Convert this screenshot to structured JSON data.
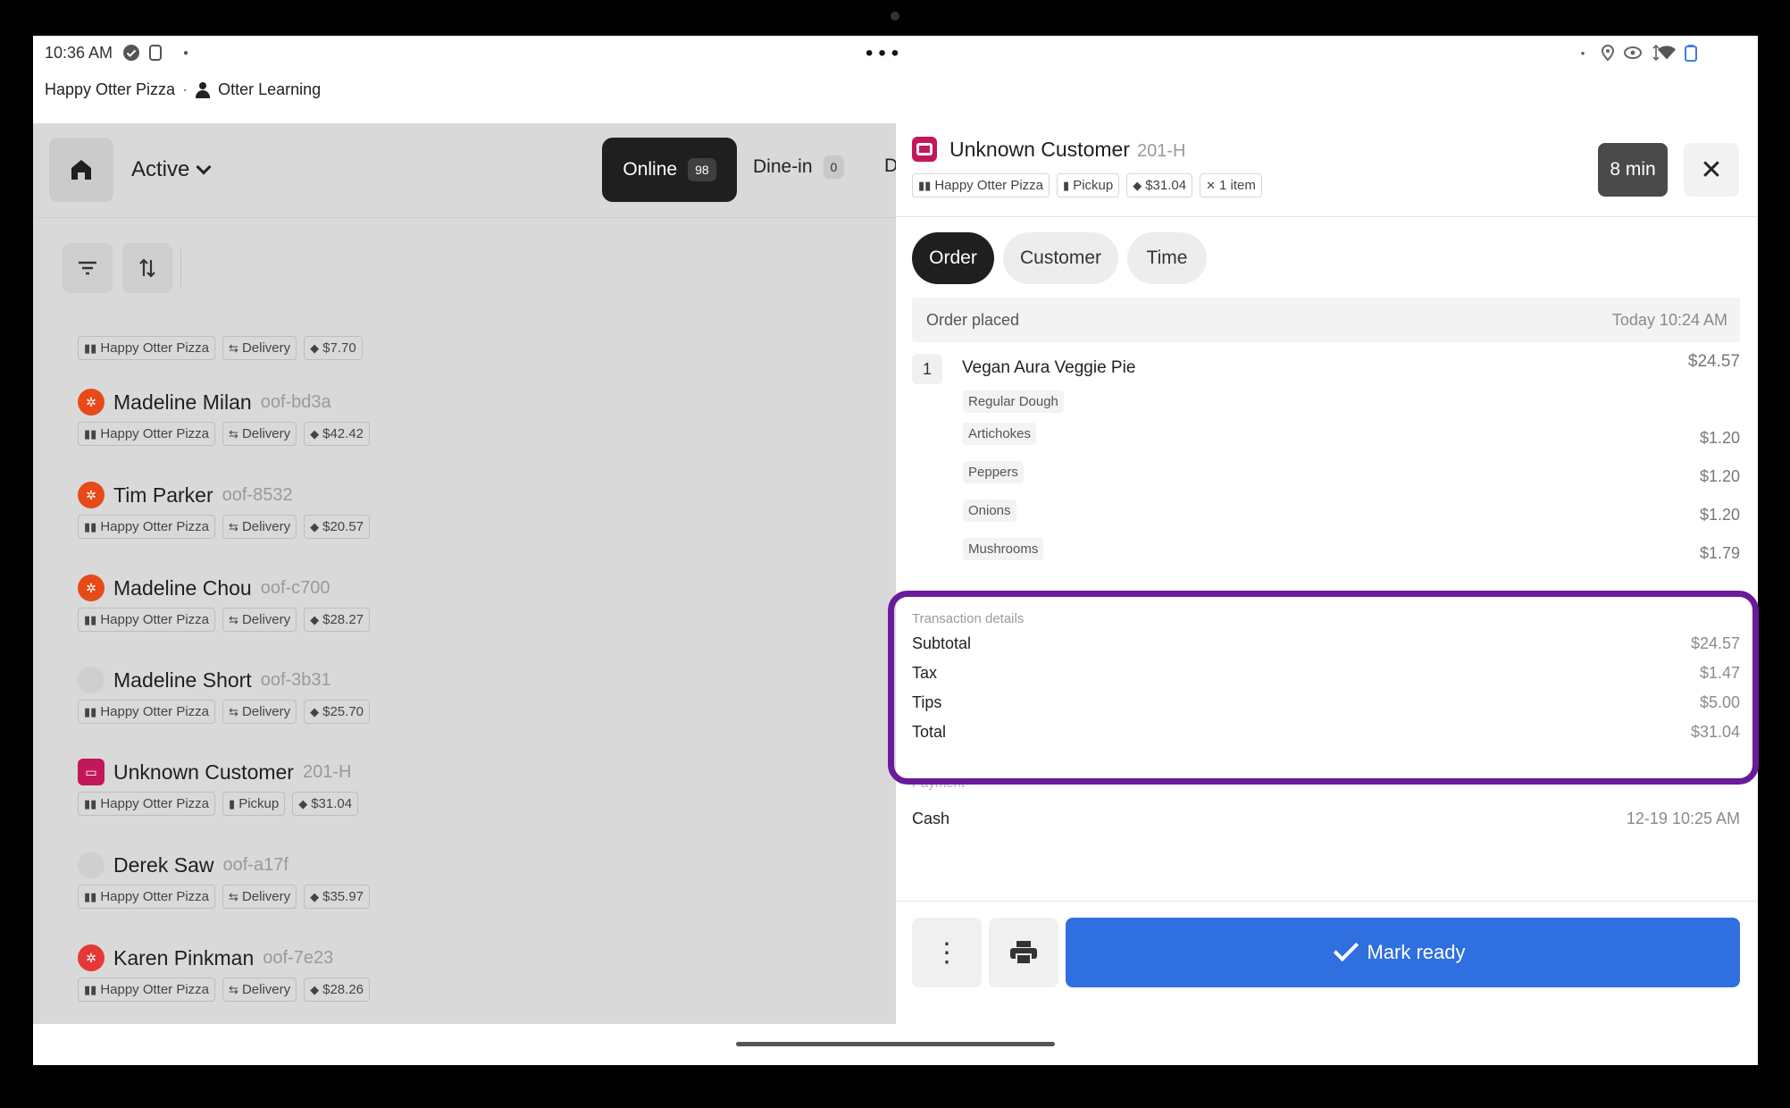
{
  "status": {
    "time": "10:36 AM",
    "store": "Happy Otter Pizza",
    "separator": "·",
    "account": "Otter Learning"
  },
  "left": {
    "filter_label": "Active",
    "tabs": [
      {
        "label": "Online",
        "count": "98"
      },
      {
        "label": "Dine-in",
        "count": "0"
      },
      {
        "label": "D"
      }
    ],
    "orders": [
      {
        "name": "",
        "id": "",
        "store": "Happy Otter Pizza",
        "type": "Delivery",
        "price": "$7.70",
        "avatar_color": "none"
      },
      {
        "name": "Madeline Milan",
        "id": "oof-bd3a",
        "store": "Happy Otter Pizza",
        "type": "Delivery",
        "price": "$42.42",
        "avatar_color": "#e64a19"
      },
      {
        "name": "Tim Parker",
        "id": "oof-8532",
        "store": "Happy Otter Pizza",
        "type": "Delivery",
        "price": "$20.57",
        "avatar_color": "#e64a19"
      },
      {
        "name": "Madeline Chou",
        "id": "oof-c700",
        "store": "Happy Otter Pizza",
        "type": "Delivery",
        "price": "$28.27",
        "avatar_color": "#e64a19"
      },
      {
        "name": "Madeline Short",
        "id": "oof-3b31",
        "store": "Happy Otter Pizza",
        "type": "Delivery",
        "price": "$25.70",
        "avatar_color": "#cfcfcf"
      },
      {
        "name": "Unknown Customer",
        "id": "201-H",
        "store": "Happy Otter Pizza",
        "type": "Pickup",
        "price": "$31.04",
        "avatar_color": "#c2185b"
      },
      {
        "name": "Derek Saw",
        "id": "oof-a17f",
        "store": "Happy Otter Pizza",
        "type": "Delivery",
        "price": "$35.97",
        "avatar_color": "#cfcfcf"
      },
      {
        "name": "Karen Pinkman",
        "id": "oof-7e23",
        "store": "Happy Otter Pizza",
        "type": "Delivery",
        "price": "$28.26",
        "avatar_color": "#e53935"
      }
    ]
  },
  "detail": {
    "customer_name": "Unknown Customer",
    "order_id": "201-H",
    "chips": {
      "store": "Happy Otter Pizza",
      "type": "Pickup",
      "price": "$31.04",
      "items": "1 item"
    },
    "timer": "8 min",
    "tabs": {
      "order": "Order",
      "customer": "Customer",
      "time": "Time"
    },
    "placed_label": "Order placed",
    "placed_time": "Today 10:24 AM",
    "item": {
      "qty": "1",
      "name": "Vegan Aura Veggie Pie",
      "price": "$24.57"
    },
    "modifiers": [
      {
        "label": "Regular Dough",
        "price": ""
      },
      {
        "label": "Artichokes",
        "price": "$1.20"
      },
      {
        "label": "Peppers",
        "price": "$1.20"
      },
      {
        "label": "Onions",
        "price": "$1.20"
      },
      {
        "label": "Mushrooms",
        "price": "$1.79"
      }
    ],
    "transaction": {
      "title": "Transaction details",
      "subtotal_label": "Subtotal",
      "subtotal": "$24.57",
      "tax_label": "Tax",
      "tax": "$1.47",
      "tips_label": "Tips",
      "tips": "$5.00",
      "total_label": "Total",
      "total": "$31.04"
    },
    "payment": {
      "title": "Payment",
      "method": "Cash",
      "time": "12-19 10:25 AM"
    },
    "mark_ready": "Mark ready"
  },
  "colors": {
    "highlight": "#6a1b9a",
    "primary": "#2f6fdf"
  }
}
